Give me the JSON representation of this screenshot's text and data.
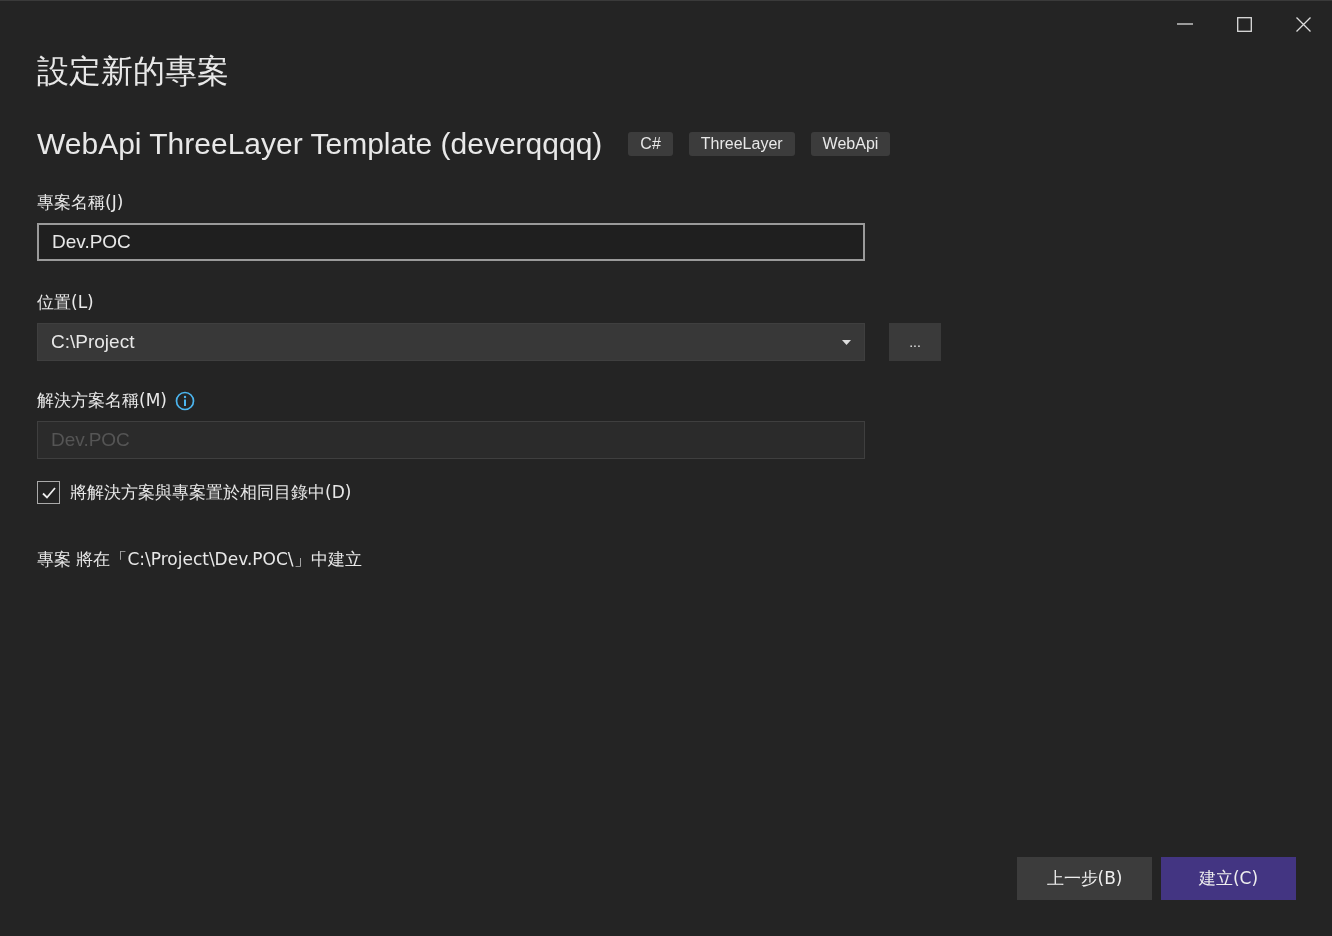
{
  "window": {
    "title": "設定新的專案"
  },
  "template": {
    "name": "WebApi ThreeLayer Template (deverqqqq)",
    "tags": [
      "C#",
      "ThreeLayer",
      "WebApi"
    ]
  },
  "project_name": {
    "label": "專案名稱(J)",
    "value": "Dev.POC"
  },
  "location": {
    "label": "位置(L)",
    "value": "C:\\Project",
    "browse_button": "..."
  },
  "solution_name": {
    "label": "解決方案名稱(M)",
    "value": "Dev.POC",
    "disabled": true
  },
  "same_directory": {
    "label": "將解決方案與專案置於相同目錄中(D)",
    "checked": true
  },
  "message": "專案 將在「C:\\Project\\Dev.POC\\」中建立",
  "buttons": [
    {
      "label": "上一步(B)",
      "kind": "secondary"
    },
    {
      "label": "建立(C)",
      "kind": "primary"
    }
  ]
}
